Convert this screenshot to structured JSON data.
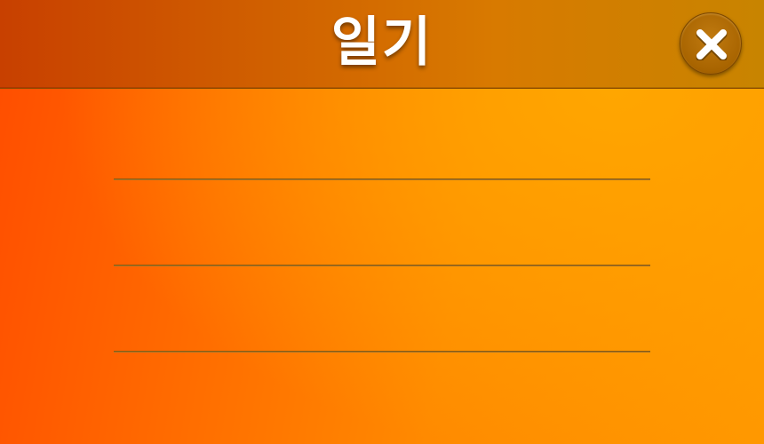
{
  "window": {
    "title": "일기"
  },
  "close_button": {
    "icon": "close-icon"
  },
  "entries": [
    {
      "text": ""
    },
    {
      "text": ""
    },
    {
      "text": ""
    }
  ],
  "colors": {
    "background_start": "#ff4d00",
    "background_end": "#ffa600",
    "titlebar": "#d06000",
    "title_text": "#ffffff",
    "line": "#8a5a10"
  }
}
